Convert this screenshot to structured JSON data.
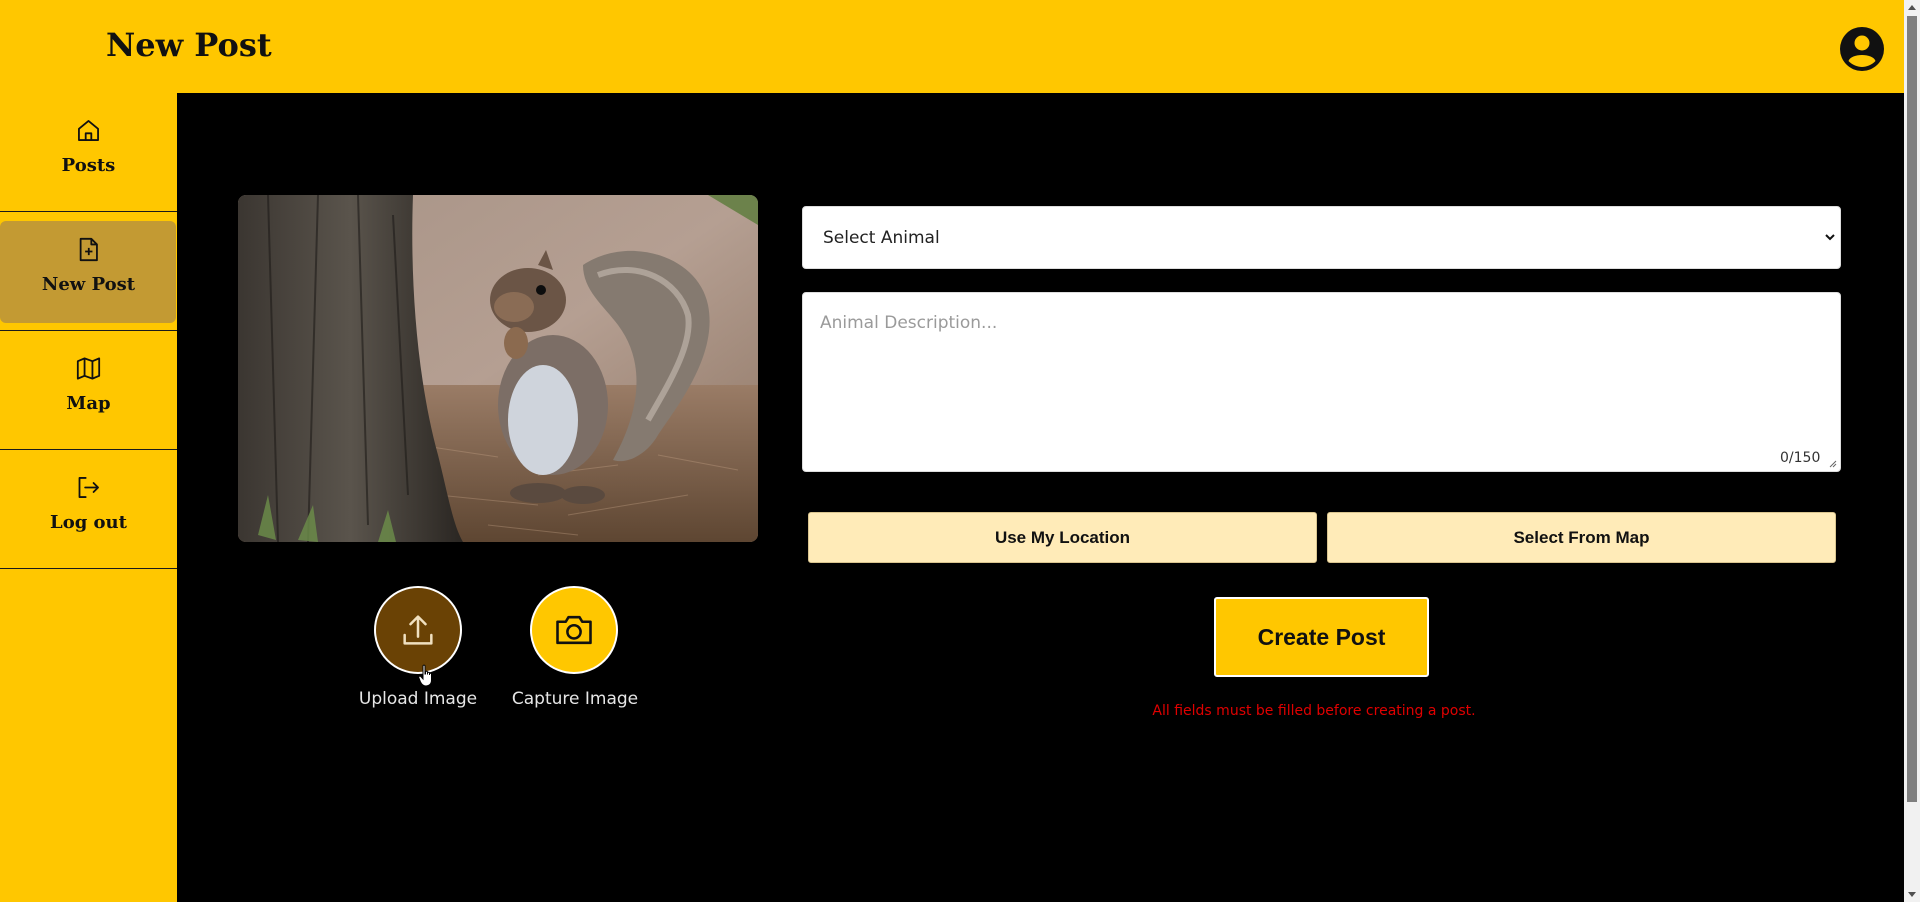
{
  "header": {
    "title": "New Post",
    "profile_icon": "account-circle-icon"
  },
  "sidebar": {
    "items": [
      {
        "label": "Posts",
        "icon": "home-icon",
        "active": false
      },
      {
        "label": "New Post",
        "icon": "file-plus-icon",
        "active": true
      },
      {
        "label": "Map",
        "icon": "map-icon",
        "active": false
      },
      {
        "label": "Log out",
        "icon": "logout-icon",
        "active": false
      }
    ]
  },
  "image_panel": {
    "preview": "squirrel photo preview",
    "upload_label": "Upload Image",
    "capture_label": "Capture Image",
    "upload_icon": "upload-icon",
    "capture_icon": "camera-icon"
  },
  "form": {
    "animal_select": {
      "selected": "Select Animal",
      "options": [
        "Select Animal"
      ]
    },
    "description": {
      "placeholder": "Animal Description...",
      "value": "",
      "counter": "0/150"
    },
    "use_location_label": "Use My Location",
    "select_from_map_label": "Select From Map",
    "create_label": "Create Post",
    "error": "All fields must be filled before creating a post."
  },
  "colors": {
    "accent": "#ffc700",
    "active_nav": "#c39a33",
    "upload_button": "#6a4205",
    "location_button": "#ffebb8",
    "error": "#e00000",
    "background": "#000000"
  }
}
